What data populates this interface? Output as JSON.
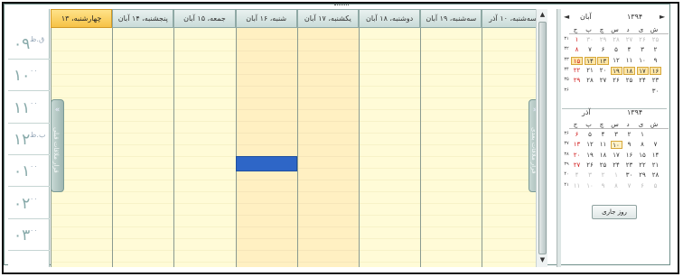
{
  "window": {
    "title": ""
  },
  "day_view": {
    "headers": [
      {
        "label": "سه‌شنبه، ۱۰ آذر"
      },
      {
        "label": "سه‌شنبه، ۱۹ آبان"
      },
      {
        "label": "دوشنبه، ۱۸ آبان"
      },
      {
        "label": "یکشنبه، ۱۷ آبان"
      },
      {
        "label": "شنبه، ۱۶ آبان"
      },
      {
        "label": "جمعه، ۱۵ آبان"
      },
      {
        "label": "پنجشنبه، ۱۴ آبان"
      },
      {
        "label": "چهارشنبه، ۱۳"
      }
    ],
    "time_slots": [
      {
        "hour": "۰۹",
        "min": "ق.ظ"
      },
      {
        "hour": "۱۰",
        "min": "۰۰"
      },
      {
        "hour": "۱۱",
        "min": "۰۰"
      },
      {
        "hour": "۱۲",
        "min": "ب.ظ"
      },
      {
        "hour": "۰۱",
        "min": "۰۰"
      },
      {
        "hour": "۰۲",
        "min": "۰۰"
      },
      {
        "hour": "۰۳",
        "min": "۰۰"
      }
    ],
    "prev_tab_label": "قرار ملاقات قبلی",
    "next_tab_label": "قرار ملاقات بعدی",
    "accent_color": "#2e66c7",
    "today_color": "#f6c246"
  },
  "calendar": {
    "top": {
      "month": "آبان",
      "year": "۱۳۹۴",
      "weekdays": [
        "ش",
        "ی",
        "د",
        "س",
        "چ",
        "پ",
        "ج"
      ],
      "weeknums": [
        "۳۱",
        "۳۲",
        "۳۳",
        "۳۴",
        "۳۵",
        "۳۶"
      ],
      "rows": [
        [
          "۲۵",
          "۲۶",
          "۲۷",
          "۲۸",
          "۲۹",
          "۳۰",
          "۱"
        ],
        [
          "۲",
          "۳",
          "۴",
          "۵",
          "۶",
          "۷",
          "۸"
        ],
        [
          "۹",
          "۱۰",
          "۱۱",
          "۱۲",
          "۱۳",
          "۱۴",
          "۱۵"
        ],
        [
          "۱۶",
          "۱۷",
          "۱۸",
          "۱۹",
          "۲۰",
          "۲۱",
          "۲۲"
        ],
        [
          "۲۳",
          "۲۴",
          "۲۵",
          "۲۶",
          "۲۷",
          "۲۸",
          "۲۹"
        ],
        [
          "۳۰",
          "",
          "",
          "",
          "",
          "",
          ""
        ]
      ]
    },
    "bottom": {
      "month": "آذر",
      "year": "۱۳۹۴",
      "weekdays": [
        "ش",
        "ی",
        "د",
        "س",
        "چ",
        "پ",
        "ج"
      ],
      "weeknums": [
        "۳۶",
        "۳۷",
        "۳۸",
        "۳۹",
        "۴۰",
        "۴۱"
      ],
      "rows": [
        [
          "",
          "۱",
          "۲",
          "۳",
          "۴",
          "۵",
          "۶"
        ],
        [
          "۷",
          "۸",
          "۹",
          "۱۰",
          "۱۱",
          "۱۲",
          "۱۳"
        ],
        [
          "۱۴",
          "۱۵",
          "۱۶",
          "۱۷",
          "۱۸",
          "۱۹",
          "۲۰"
        ],
        [
          "۲۱",
          "۲۲",
          "۲۳",
          "۲۴",
          "۲۵",
          "۲۶",
          "۲۷"
        ],
        [
          "۲۸",
          "۲۹",
          "۳۰",
          "۱",
          "۲",
          "۳",
          "۴"
        ],
        [
          "۵",
          "۶",
          "۷",
          "۸",
          "۹",
          "۱۰",
          "۱۱"
        ]
      ]
    },
    "today_button": "روز جاری"
  }
}
